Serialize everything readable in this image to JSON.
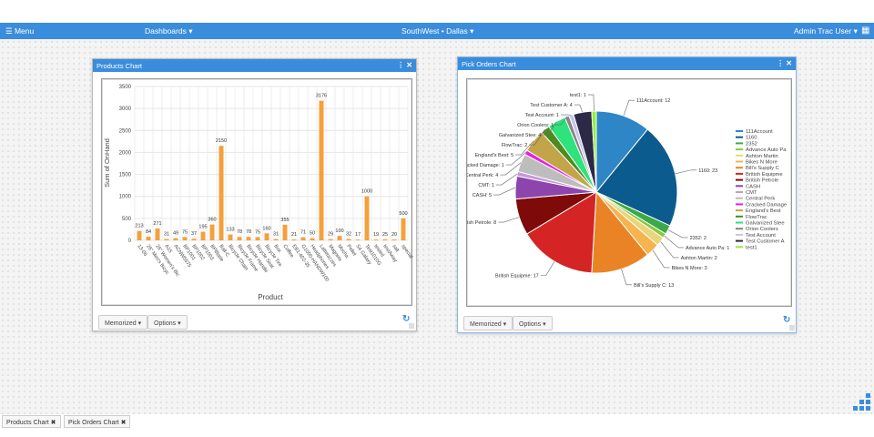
{
  "topbar": {
    "menu": "☰ Menu",
    "dashboards": "Dashboards ▾",
    "location": "SouthWest • Dallas ▾",
    "user": "Admin Trac User ▾",
    "grid_icon": "grid-icon"
  },
  "panels": {
    "products": {
      "title": "Products Chart",
      "controls": "⋮ ✕",
      "memorized": "Memorized ▾",
      "options": "Options ▾"
    },
    "pick_orders": {
      "title": "Pick Orders Chart",
      "controls": "⋮ ✕",
      "memorized": "Memorized ▾",
      "options": "Options ▾"
    }
  },
  "taskbar": [
    {
      "label": "Products Chart ✖"
    },
    {
      "label": "Pick Orders Chart ✖"
    }
  ],
  "chart_data": [
    {
      "type": "bar",
      "title": "",
      "xlabel": "Product",
      "ylabel": "Sum of OnHand",
      "ylim": [
        0,
        3500
      ],
      "yticks": [
        0,
        500,
        1000,
        1500,
        2000,
        2500,
        3000,
        3500
      ],
      "grid": true,
      "color": "#f5a03c",
      "categories": [
        "13-06",
        "26\" Men's Bicyc",
        "26\" Women's Bic",
        "A15",
        "ACNW5575",
        "BP1001",
        "BP1002",
        "BP1003",
        "BPBlade",
        "Ball-C",
        "Bicycle Chain",
        "Bicycle Frame",
        "Bicycle Handle",
        "Bicycle Seat",
        "Bicycle Tire",
        "Box",
        "Coffee",
        "EB1-402-35",
        "G1000-HANDW100",
        "Headphones",
        "Lattetazzes",
        "Magnets",
        "Mocha",
        "Pellet",
        "S4 Galaxy",
        "Test1010G",
        "tested",
        "testAway",
        "salt",
        "special"
      ],
      "values": [
        213,
        84,
        271,
        31,
        49,
        75,
        37,
        195,
        360,
        2150,
        133,
        78,
        78,
        75,
        160,
        31,
        355,
        21,
        71,
        50,
        3176,
        29,
        100,
        32,
        17,
        1000,
        19,
        25,
        20,
        500
      ]
    },
    {
      "type": "pie",
      "title": "",
      "legend": "right",
      "slices": [
        {
          "name": "111Account",
          "value": 12,
          "color": "#2f86c6"
        },
        {
          "name": "1160",
          "value": 23,
          "color": "#0c5b8e"
        },
        {
          "name": "2352",
          "value": 2,
          "color": "#3aaa48"
        },
        {
          "name": "Advance Auto Pa",
          "value": 1,
          "color": "#8cc63f"
        },
        {
          "name": "Ashton Martin",
          "value": 2,
          "color": "#e9d57a"
        },
        {
          "name": "Bikes N More",
          "value": 3,
          "color": "#f5b450"
        },
        {
          "name": "Bill's Supply C",
          "value": 13,
          "color": "#ea8325"
        },
        {
          "name": "British Equipme",
          "value": 17,
          "color": "#d42424"
        },
        {
          "name": "British Petrole",
          "value": 8,
          "color": "#7f0a0a"
        },
        {
          "name": "CASH",
          "value": 5,
          "color": "#8e44ad"
        },
        {
          "name": "CMT",
          "value": 1,
          "color": "#c49ad8"
        },
        {
          "name": "Central Perk",
          "value": 4,
          "color": "#bdbdbd"
        },
        {
          "name": "Cracked Damage",
          "value": 1,
          "color": "#e620e0"
        },
        {
          "name": "England's Best",
          "value": 5,
          "color": "#c2a548"
        },
        {
          "name": "FlowTrac",
          "value": 2,
          "color": "#4f8a1f"
        },
        {
          "name": "Galvanized Stee",
          "value": 4,
          "color": "#2ee27c"
        },
        {
          "name": "Orion Coolers",
          "value": 1,
          "color": "#858585"
        },
        {
          "name": "Test Account",
          "value": 1,
          "color": "#c6c6ea"
        },
        {
          "name": "Test Customer A",
          "value": 4,
          "color": "#2b2946"
        },
        {
          "name": "test1",
          "value": 1,
          "color": "#8ef03c"
        }
      ]
    }
  ]
}
